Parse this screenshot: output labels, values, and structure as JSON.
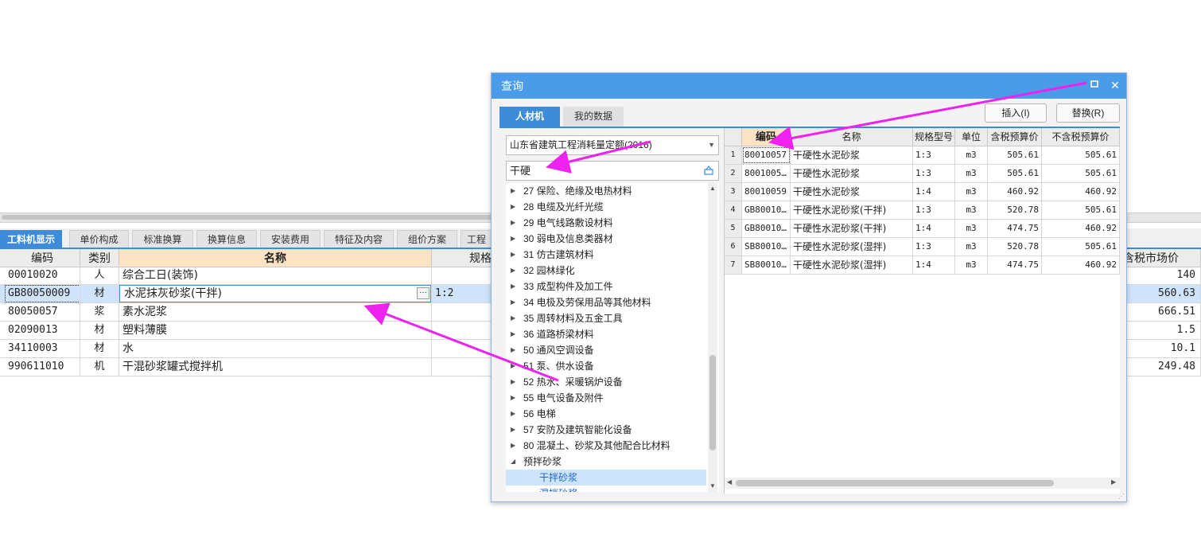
{
  "main": {
    "tabs": [
      {
        "label": "工料机显示",
        "active": true
      },
      {
        "label": "单价构成"
      },
      {
        "label": "标准换算"
      },
      {
        "label": "换算信息"
      },
      {
        "label": "安装费用"
      },
      {
        "label": "特征及内容"
      },
      {
        "label": "组价方案"
      },
      {
        "label": "工程"
      }
    ],
    "columns": {
      "code": "编码",
      "type": "类别",
      "name": "名称",
      "spec": "规格",
      "price": "含税市场价"
    },
    "rows": [
      {
        "code": "00010020",
        "type": "人",
        "name": "综合工日(装饰)",
        "spec": "",
        "price": "140"
      },
      {
        "code": "GB80050009",
        "type": "材",
        "name": "水泥抹灰砂浆(干拌)",
        "spec": "1:2",
        "price": "560.63"
      },
      {
        "code": "80050057",
        "type": "浆",
        "name": "素水泥浆",
        "spec": "",
        "price": "666.51"
      },
      {
        "code": "02090013",
        "type": "材",
        "name": "塑料薄膜",
        "spec": "",
        "price": "1.5"
      },
      {
        "code": "34110003",
        "type": "材",
        "name": "水",
        "spec": "",
        "price": "10.1"
      },
      {
        "code": "990611010",
        "type": "机",
        "name": "干混砂浆罐式搅拌机",
        "spec": "",
        "price": "249.48"
      }
    ]
  },
  "dialog": {
    "title": "查询",
    "tabs": [
      {
        "label": "人材机"
      },
      {
        "label": "我的数据"
      }
    ],
    "insert_label": "插入(I)",
    "replace_label": "替换(R)",
    "library": "山东省建筑工程消耗量定额(2016)",
    "search_value": "干硬",
    "tree": [
      "27 保险、绝缘及电热材料",
      "28 电缆及光纤光缆",
      "29 电气线路敷设材料",
      "30 弱电及信息类器材",
      "31 仿古建筑材料",
      "32 园林绿化",
      "33 成型构件及加工件",
      "34 电极及劳保用品等其他材料",
      "35 周转材料及五金工具",
      "36 道路桥梁材料",
      "50 通风空调设备",
      "51 泵、供水设备",
      "52 热水、采暖锅炉设备",
      "55 电气设备及附件",
      "56 电梯",
      "57 安防及建筑智能化设备",
      "80 混凝土、砂浆及其他配合比材料",
      "预拌砂浆",
      "干拌砂浆",
      "湿拌砂浆"
    ],
    "result_columns": {
      "idx": "",
      "code": "编码",
      "name": "名称",
      "spec": "规格型号",
      "unit": "单位",
      "tax_price": "含税预算价",
      "notax_price": "不含税预算价"
    },
    "results": [
      {
        "idx": "1",
        "code": "80010057",
        "name": "干硬性水泥砂浆",
        "spec": "1:3",
        "unit": "m3",
        "tax_price": "505.61",
        "notax_price": "505.61"
      },
      {
        "idx": "2",
        "code": "8001005…",
        "name": "干硬性水泥砂浆",
        "spec": "1:3",
        "unit": "m3",
        "tax_price": "505.61",
        "notax_price": "505.61"
      },
      {
        "idx": "3",
        "code": "80010059",
        "name": "干硬性水泥砂浆",
        "spec": "1:4",
        "unit": "m3",
        "tax_price": "460.92",
        "notax_price": "460.92"
      },
      {
        "idx": "4",
        "code": "GB80010…",
        "name": "干硬性水泥砂浆(干拌)",
        "spec": "1:3",
        "unit": "m3",
        "tax_price": "520.78",
        "notax_price": "505.61"
      },
      {
        "idx": "5",
        "code": "GB80010…",
        "name": "干硬性水泥砂浆(干拌)",
        "spec": "1:4",
        "unit": "m3",
        "tax_price": "474.75",
        "notax_price": "460.92"
      },
      {
        "idx": "6",
        "code": "SB80010…",
        "name": "干硬性水泥砂浆(湿拌)",
        "spec": "1:3",
        "unit": "m3",
        "tax_price": "520.78",
        "notax_price": "505.61"
      },
      {
        "idx": "7",
        "code": "SB80010…",
        "name": "干硬性水泥砂浆(湿拌)",
        "spec": "1:4",
        "unit": "m3",
        "tax_price": "474.75",
        "notax_price": "460.92"
      }
    ]
  },
  "colors": {
    "accent": "#3d8bd9",
    "title_bar": "#4a9be8",
    "header_highlight": "#fde3c4",
    "arrow": "#ee22ee"
  }
}
